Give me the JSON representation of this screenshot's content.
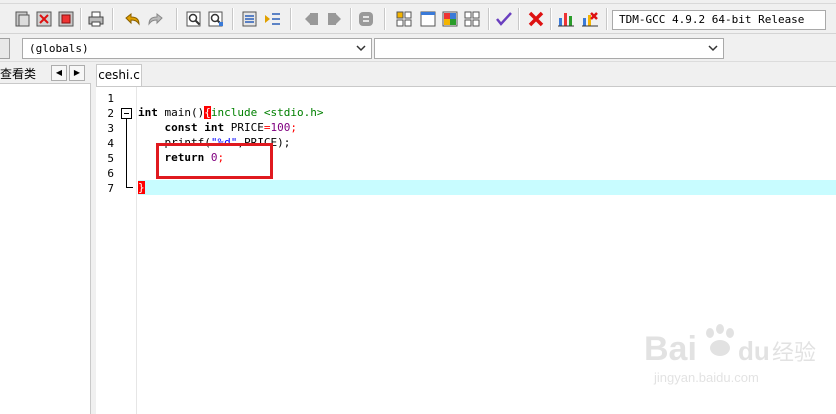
{
  "toolbar": {
    "compiler": "TDM-GCC 4.9.2 64-bit Release",
    "icons": [
      "new-file",
      "open",
      "close-file",
      "print",
      "undo",
      "redo",
      "find",
      "replace",
      "indent",
      "unindent",
      "bookmark-prev",
      "bookmark-next",
      "comment",
      "layout-1",
      "layout-2",
      "layout-3",
      "layout-4",
      "check",
      "delete",
      "chart",
      "stop"
    ]
  },
  "scope_bar": {
    "scope_value": "(globals)",
    "function_value": ""
  },
  "class_browser": {
    "tab_label": "查看类",
    "prev": "◀",
    "next": "▶"
  },
  "editor": {
    "file_tab": "ceshi.c",
    "line_numbers": [
      "1",
      "2",
      "3",
      "4",
      "5",
      "6",
      "7"
    ],
    "code": {
      "l1": {
        "pp": "#include <stdio.h>"
      },
      "l2": {
        "kw1": "int",
        "fn": " main()",
        "brace": "{"
      },
      "l3": {
        "indent": "    ",
        "kw1": "const",
        "sp": " ",
        "kw2": "int",
        "id": " PRICE",
        "op": "=",
        "num": "100",
        "end": ";"
      },
      "l4": {
        "indent": "    ",
        "fn": "printf(",
        "str": "\"%d\"",
        "rest": ",PRICE);"
      },
      "l5": {
        "indent": "    ",
        "kw": "return",
        "sp": " ",
        "num": "0",
        "end": ";"
      },
      "l6": {},
      "l7": {
        "brace": "}"
      }
    }
  },
  "watermark": {
    "brand": "Bai",
    "brand2": "du",
    "cn": "经验",
    "url": "jingyan.baidu.com"
  },
  "colors": {
    "current_line": "#c8fcff",
    "annotation": "#e0191f",
    "preprocessor": "#008000",
    "number": "#800080",
    "string": "#0000ff",
    "symbol": "#ff0000"
  }
}
